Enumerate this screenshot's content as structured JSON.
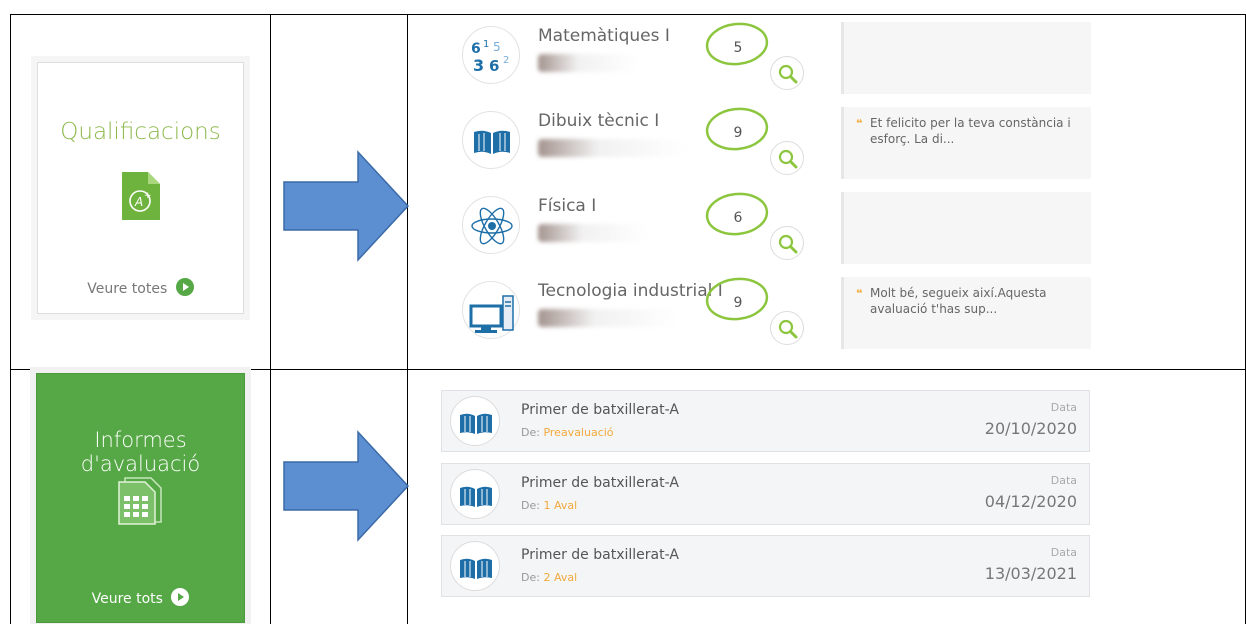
{
  "tiles": {
    "qualifications": {
      "title": "Qualificacions",
      "see_all": "Veure totes",
      "color": "#8cb84a"
    },
    "reports": {
      "title_line1": "Informes",
      "title_line2": "d'avaluació",
      "see_all": "Veure tots",
      "color": "#55a845"
    }
  },
  "grades": [
    {
      "subject": "Matemàtiques I",
      "grade": "5",
      "icon": "math-icon",
      "comment": ""
    },
    {
      "subject": "Dibuix tècnic I",
      "grade": "9",
      "icon": "book-icon",
      "comment": "Et felicito per la teva constància i esforç. La di..."
    },
    {
      "subject": "Física I",
      "grade": "6",
      "icon": "atom-icon",
      "comment": ""
    },
    {
      "subject": "Tecnologia industrial I",
      "grade": "9",
      "icon": "computer-icon",
      "comment": "Molt bé, segueix així.Aquesta avaluació t'has sup..."
    }
  ],
  "reports": [
    {
      "title": "Primer de batxillerat-A",
      "from_label": "De:",
      "from_value": "Preavaluació",
      "date_label": "Data",
      "date": "20/10/2020"
    },
    {
      "title": "Primer de batxillerat-A",
      "from_label": "De:",
      "from_value": "1 Aval",
      "date_label": "Data",
      "date": "04/12/2020"
    },
    {
      "title": "Primer de batxillerat-A",
      "from_label": "De:",
      "from_value": "2 Aval",
      "date_label": "Data",
      "date": "13/03/2021"
    }
  ],
  "colors": {
    "arrow": "#5b8fd1",
    "grade_ring": "#8cc63f",
    "accent_orange": "#f2a93b",
    "book_blue": "#1e6fa8"
  }
}
